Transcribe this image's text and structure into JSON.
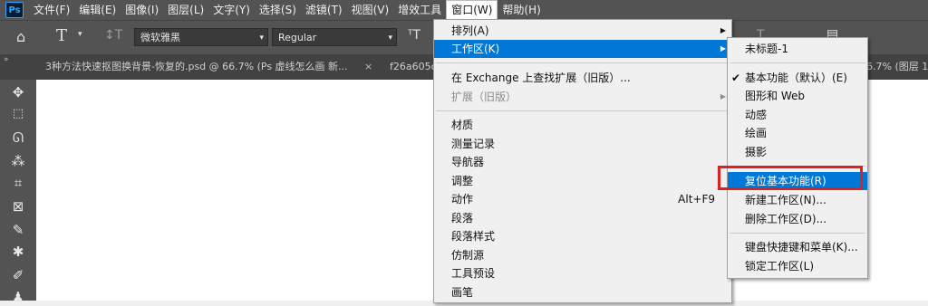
{
  "menubar": {
    "logo": "Ps",
    "items": [
      "文件(F)",
      "编辑(E)",
      "图像(I)",
      "图层(L)",
      "文字(Y)",
      "选择(S)",
      "滤镜(T)",
      "视图(V)",
      "增效工具",
      "窗口(W)",
      "帮助(H)"
    ]
  },
  "options": {
    "font_family": "微软雅黑",
    "font_style": "Regular"
  },
  "tabs": [
    "3种方法快速抠图换背景-恢复的.psd @ 66.7% (Ps 虚线怎么画 新...",
    "f26a605c",
    "6.7% (图层 1"
  ],
  "window_menu": {
    "items": [
      {
        "label": "排列(A)",
        "arrow": "▶"
      },
      {
        "label": "工作区(K)",
        "arrow": "▶"
      },
      {
        "label": "在 Exchange 上查找扩展（旧版）..."
      },
      {
        "label": "扩展（旧版）",
        "arrow": "▶"
      },
      {
        "label": "材质"
      },
      {
        "label": "测量记录"
      },
      {
        "label": "导航器"
      },
      {
        "label": "调整"
      },
      {
        "label": "动作",
        "shortcut": "Alt+F9"
      },
      {
        "label": "段落"
      },
      {
        "label": "段落样式"
      },
      {
        "label": "仿制源"
      },
      {
        "label": "工具预设"
      },
      {
        "label": "画笔"
      }
    ]
  },
  "workspace_menu": {
    "items": [
      {
        "label": "未标题-1"
      },
      {
        "label": "基本功能（默认）(E)",
        "check": "✔"
      },
      {
        "label": "图形和 Web"
      },
      {
        "label": "动感"
      },
      {
        "label": "绘画"
      },
      {
        "label": "摄影"
      },
      {
        "label": "复位基本功能(R)"
      },
      {
        "label": "新建工作区(N)..."
      },
      {
        "label": "删除工作区(D)..."
      },
      {
        "label": "键盘快捷键和菜单(K)..."
      },
      {
        "label": "锁定工作区(L)"
      }
    ]
  },
  "colors": {
    "highlight": "#0078d7",
    "annotation_box": "#e0201f"
  }
}
